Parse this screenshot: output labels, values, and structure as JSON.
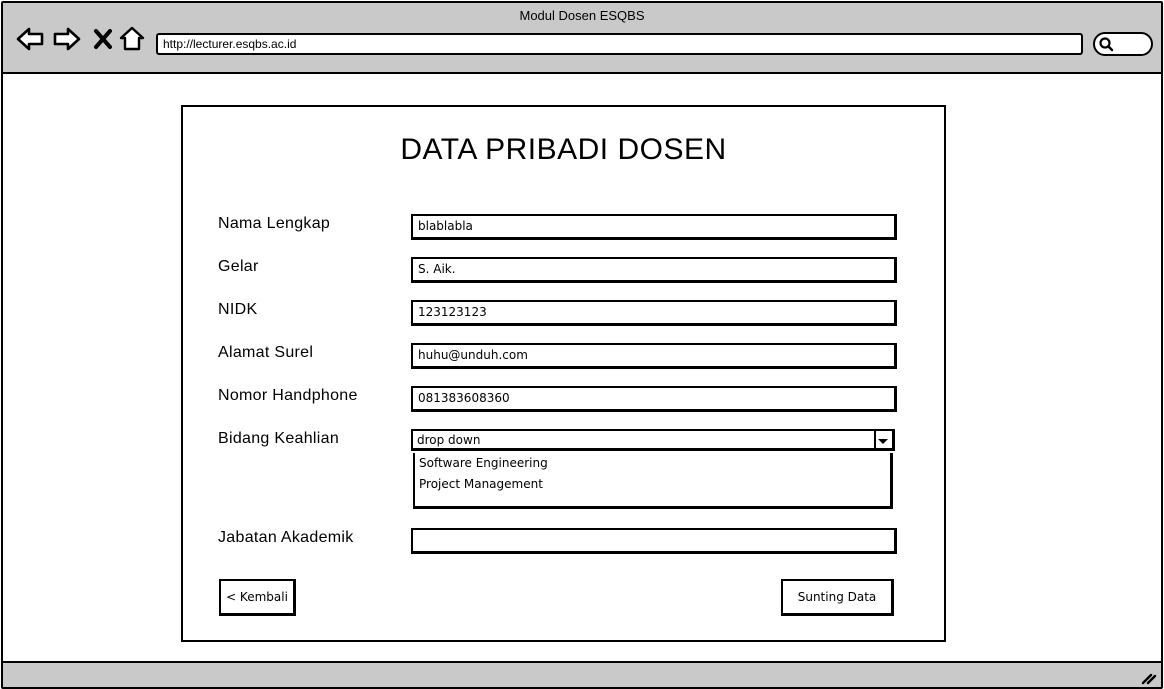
{
  "window": {
    "title": "Modul Dosen ESQBS"
  },
  "browser": {
    "url": "http://lecturer.esqbs.ac.id",
    "nav_icons": [
      "back-arrow-icon",
      "forward-arrow-icon",
      "close-icon",
      "home-icon"
    ],
    "search_icon": "search-icon"
  },
  "form": {
    "title": "DATA PRIBADI DOSEN",
    "fields": {
      "nama": {
        "label": "Nama Lengkap",
        "value": "blablabla"
      },
      "gelar": {
        "label": "Gelar",
        "value": "S. Aik."
      },
      "nidk": {
        "label": "NIDK",
        "value": "123123123"
      },
      "surel": {
        "label": "Alamat Surel",
        "value": "huhu@unduh.com"
      },
      "hp": {
        "label": "Nomor Handphone",
        "value": "081383608360"
      },
      "bidang": {
        "label": "Bidang Keahlian",
        "value": "drop down",
        "options": [
          "Software Engineering",
          "Project Management"
        ]
      },
      "jabatan": {
        "label": "Jabatan Akademik",
        "value": ""
      }
    },
    "buttons": {
      "back": "< Kembali",
      "edit": "Sunting Data"
    }
  }
}
